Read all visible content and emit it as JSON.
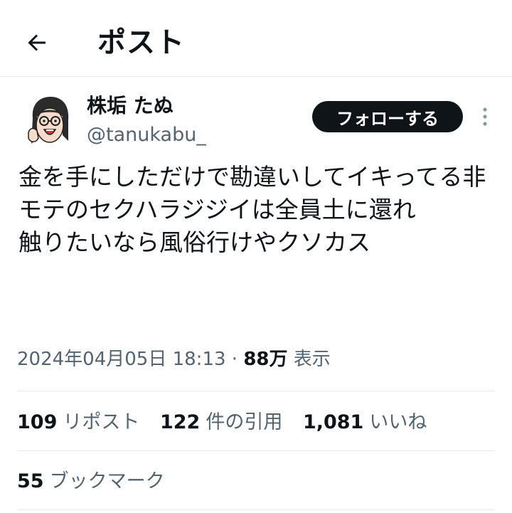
{
  "header": {
    "back_icon": "arrow-left-icon",
    "title": "ポスト"
  },
  "author": {
    "display_name": "株垢 たぬ",
    "handle": "@tanukabu_",
    "avatar_icon": "avatar-illustration"
  },
  "follow_label": "フォローする",
  "more_icon": "more-vertical-icon",
  "tweet": {
    "text": "金を手にしただけで勘違いしてイキってる非モテのセクハラジジイは全員土に還れ\n触りたいなら風俗行けやクソカス"
  },
  "meta": {
    "timestamp": "2024年04月05日 18:13",
    "separator": "·",
    "views_count": "88万",
    "views_label": "表示"
  },
  "stats": [
    {
      "count": "109",
      "label": "リポスト"
    },
    {
      "count": "122",
      "label": "件の引用"
    },
    {
      "count": "1,081",
      "label": "いいね"
    }
  ],
  "bookmarks": {
    "count": "55",
    "label": "ブックマーク"
  },
  "colors": {
    "text": "#0f1419",
    "secondary": "#536471",
    "divider": "#e6e9eb",
    "button_bg": "#0f1419",
    "button_text": "#ffffff"
  }
}
